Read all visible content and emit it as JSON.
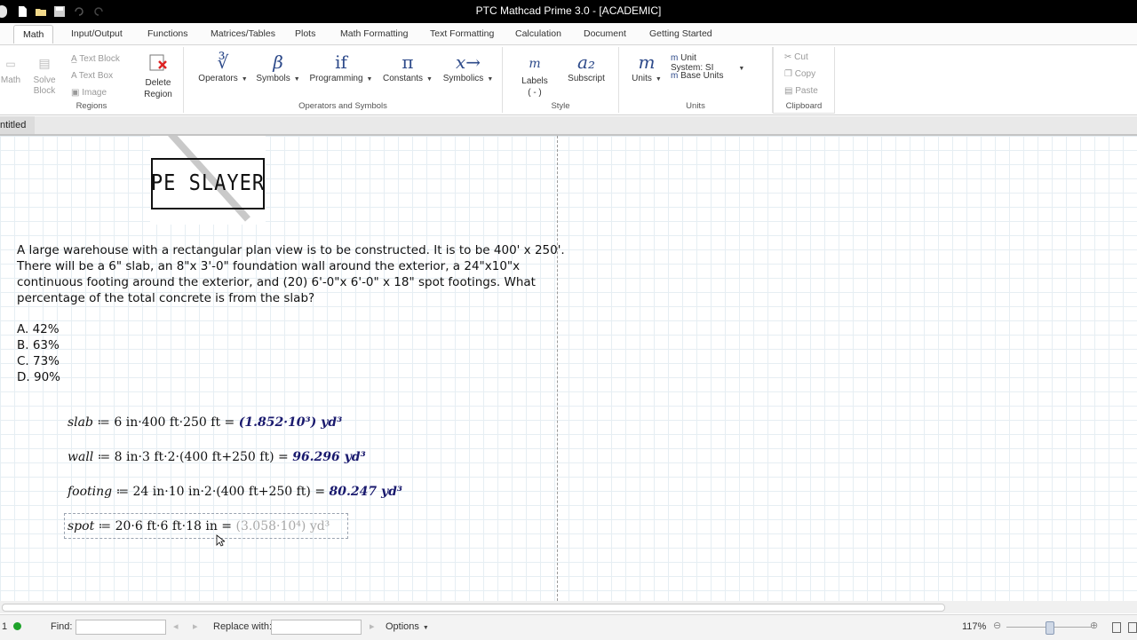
{
  "window": {
    "title": "PTC Mathcad Prime 3.0 - [ACADEMIC]"
  },
  "tabs": [
    "Math",
    "Input/Output",
    "Functions",
    "Matrices/Tables",
    "Plots",
    "Math Formatting",
    "Text Formatting",
    "Calculation",
    "Document",
    "Getting Started"
  ],
  "ribbon": {
    "regions": {
      "label": "Regions",
      "math": "Math",
      "solve_block": "Solve Block",
      "text_block": "Text Block",
      "text_box": "Text Box",
      "image": "Image",
      "delete_region": "Delete Region"
    },
    "operators": {
      "label": "Operators and Symbols",
      "operators": "Operators",
      "symbols": "Symbols",
      "programming": "Programming",
      "constants": "Constants",
      "symbolics": "Symbolics"
    },
    "style": {
      "label": "Style",
      "labels": "Labels",
      "labels_value": "( - )",
      "subscript": "Subscript"
    },
    "units": {
      "label": "Units",
      "units": "Units",
      "unit_system_label": "Unit System:",
      "unit_system_value": "SI",
      "base_units": "Base Units"
    },
    "clipboard": {
      "label": "Clipboard",
      "cut": "Cut",
      "copy": "Copy",
      "paste": "Paste"
    }
  },
  "document": {
    "tab_name": "ntitled"
  },
  "worksheet": {
    "logo_text": "PE SLAYER",
    "problem": [
      "A large warehouse with a rectangular plan view is to be constructed. It is to be 400' x 250'.",
      "There will be a 6\" slab, an 8\"x 3'-0\" foundation wall around the exterior, a 24\"x10\"x",
      "continuous footing around the exterior, and (20) 6'-0\"x 6'-0\" x 18\" spot footings. What",
      "percentage of the total concrete is from the slab?"
    ],
    "choices": [
      "A. 42%",
      "B. 63%",
      "C. 73%",
      "D. 90%"
    ],
    "equations": {
      "slab": {
        "var": "slab",
        "expr": "6 in·400 ft·250 ft",
        "result": "(1.852·10³) yd³"
      },
      "wall": {
        "var": "wall",
        "expr": "8 in·3 ft·2·(400 ft+250 ft)",
        "result": "96.296 yd³"
      },
      "footing": {
        "var": "footing",
        "expr": "24 in·10 in·2·(400 ft+250 ft)",
        "result": "80.247 yd³"
      },
      "spot": {
        "var": "spot",
        "expr": "20·6 ft·6 ft·18 in",
        "result": "(3.058·10⁴) yd³"
      }
    }
  },
  "status": {
    "page": "1",
    "find_label": "Find:",
    "replace_label": "Replace with:",
    "options": "Options",
    "zoom": "117%"
  }
}
